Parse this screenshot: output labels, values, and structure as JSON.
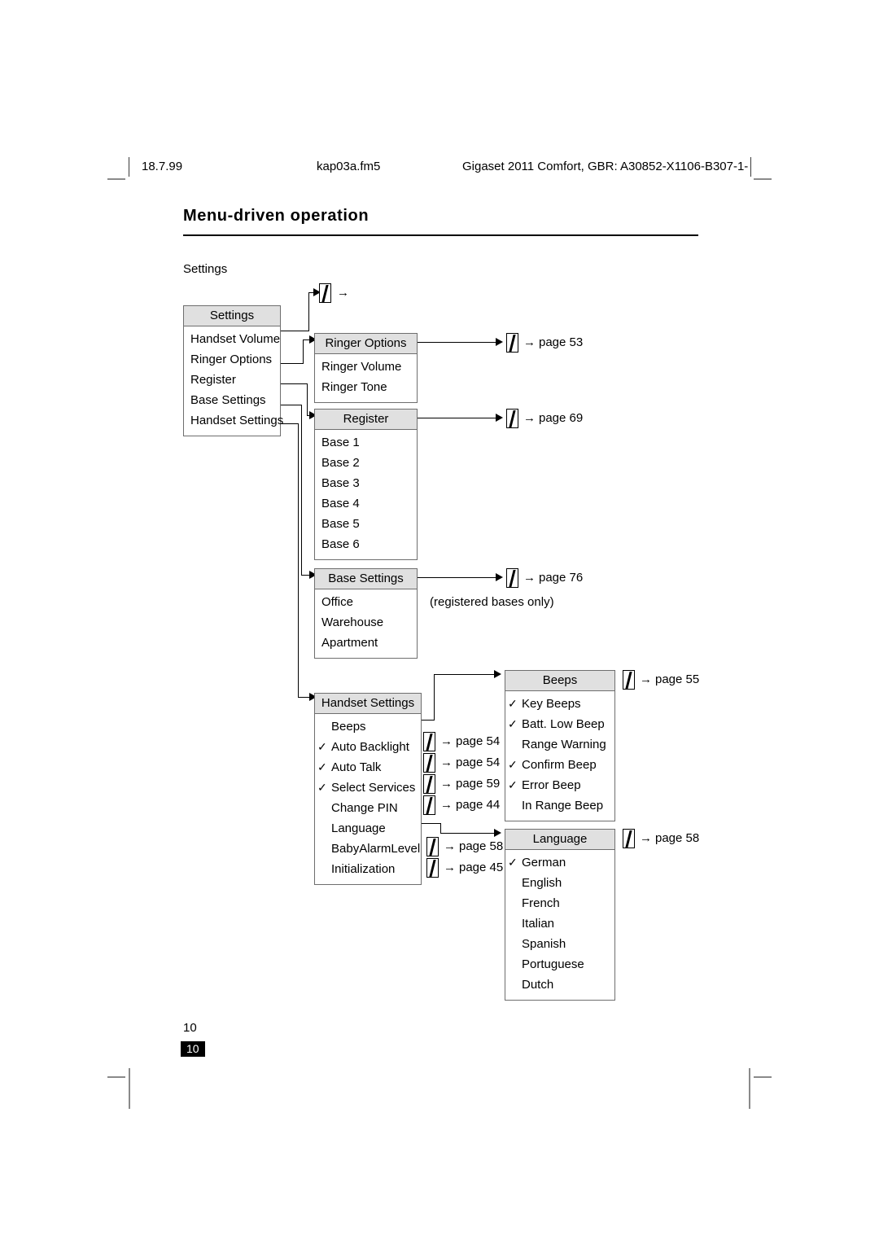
{
  "header": {
    "date": "18.7.99",
    "filename": "kap03a.fm5",
    "document": "Gigaset 2011 Comfort, GBR: A30852-X1106-B307-1-"
  },
  "title": "Menu-driven operation",
  "section_label": "Settings",
  "icons": {
    "display_key": "display-key-icon",
    "right_arrow": "→"
  },
  "root_arrow": {
    "arrow": "→"
  },
  "boxes": {
    "settings": {
      "title": "Settings",
      "items": [
        {
          "label": "Handset Volume",
          "checked": false
        },
        {
          "label": "Ringer Options",
          "checked": false
        },
        {
          "label": "Register",
          "checked": false
        },
        {
          "label": "Base Settings",
          "checked": false
        },
        {
          "label": "Handset Settings",
          "checked": false
        }
      ]
    },
    "ringer_options": {
      "title": "Ringer Options",
      "items": [
        {
          "label": "Ringer Volume",
          "checked": false
        },
        {
          "label": "Ringer Tone",
          "checked": false
        }
      ],
      "page_ref": "page 53"
    },
    "register": {
      "title": "Register",
      "items": [
        {
          "label": "Base 1",
          "checked": false
        },
        {
          "label": "Base 2",
          "checked": false
        },
        {
          "label": "Base 3",
          "checked": false
        },
        {
          "label": "Base 4",
          "checked": false
        },
        {
          "label": "Base 5",
          "checked": false
        },
        {
          "label": "Base 6",
          "checked": false
        }
      ],
      "page_ref": "page 69"
    },
    "base_settings": {
      "title": "Base Settings",
      "items": [
        {
          "label": "Office",
          "checked": false
        },
        {
          "label": "Warehouse",
          "checked": false
        },
        {
          "label": "Apartment",
          "checked": false
        }
      ],
      "page_ref": "page 76",
      "note": "(registered bases only)"
    },
    "handset_settings": {
      "title": "Handset Settings",
      "items": [
        {
          "label": "Beeps",
          "checked": false
        },
        {
          "label": "Auto Backlight",
          "checked": true
        },
        {
          "label": "Auto Talk",
          "checked": true
        },
        {
          "label": "Select Services",
          "checked": true
        },
        {
          "label": "Change PIN",
          "checked": false
        },
        {
          "label": "Language",
          "checked": false
        },
        {
          "label": "BabyAlarmLevel",
          "checked": false
        },
        {
          "label": "Initialization",
          "checked": false
        }
      ],
      "page_refs": [
        "page 54",
        "page 54",
        "page 59",
        "page 44",
        "page 58",
        "page 45"
      ]
    },
    "beeps": {
      "title": "Beeps",
      "items": [
        {
          "label": "Key Beeps",
          "checked": true
        },
        {
          "label": "Batt. Low Beep",
          "checked": true
        },
        {
          "label": "Range Warning",
          "checked": false
        },
        {
          "label": "Confirm Beep",
          "checked": true
        },
        {
          "label": "Error Beep",
          "checked": true
        },
        {
          "label": "In Range Beep",
          "checked": false
        }
      ],
      "page_ref": "page 55"
    },
    "language": {
      "title": "Language",
      "items": [
        {
          "label": "German",
          "checked": true
        },
        {
          "label": "English",
          "checked": false
        },
        {
          "label": "French",
          "checked": false
        },
        {
          "label": "Italian",
          "checked": false
        },
        {
          "label": "Spanish",
          "checked": false
        },
        {
          "label": "Portuguese",
          "checked": false
        },
        {
          "label": "Dutch",
          "checked": false
        }
      ],
      "page_ref": "page 58"
    }
  },
  "footer": {
    "folio_plain": "10",
    "folio_box": "10"
  },
  "tick_glyph": "✓",
  "arrow_glyph": "→"
}
